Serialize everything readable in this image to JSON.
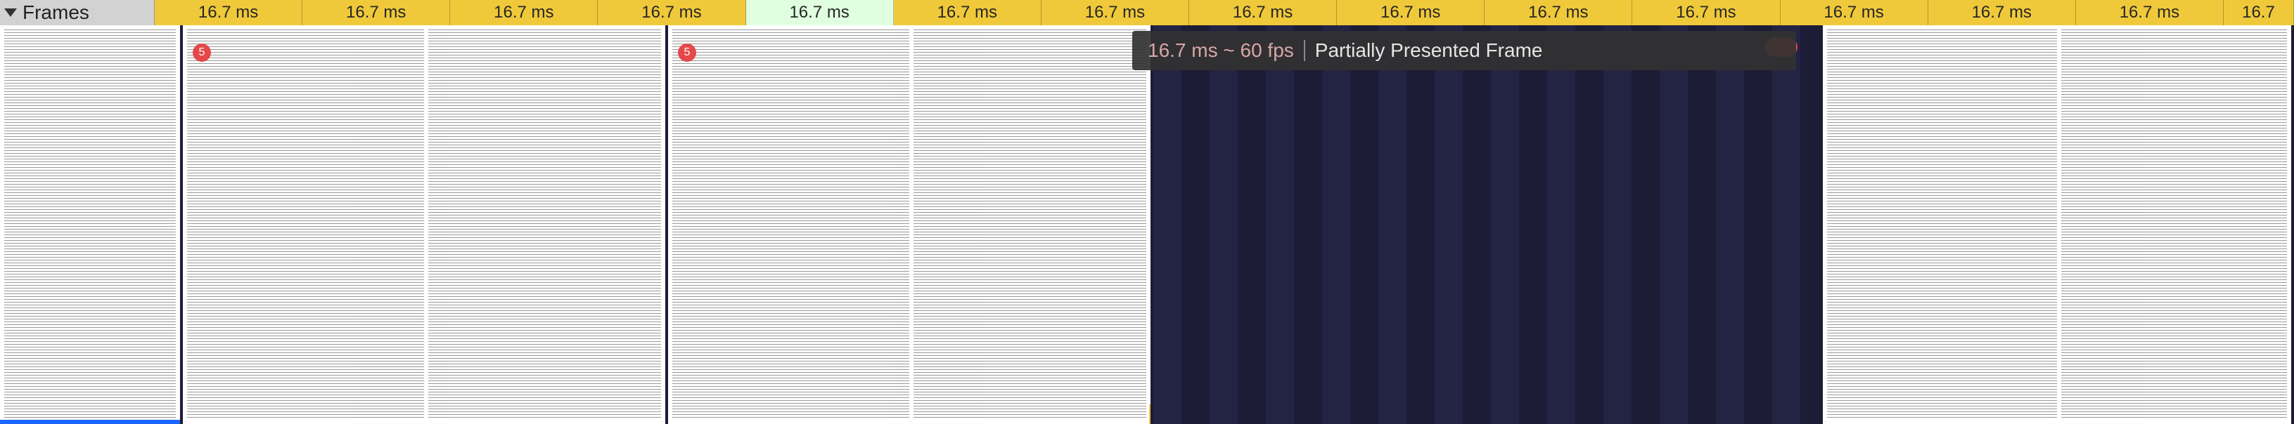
{
  "frames": {
    "row_label": "Frames",
    "cells": [
      {
        "label": "16.7 ms",
        "kind": "gold"
      },
      {
        "label": "16.7 ms",
        "kind": "gold"
      },
      {
        "label": "16.7 ms",
        "kind": "gold"
      },
      {
        "label": "16.7 ms",
        "kind": "gold"
      },
      {
        "label": "16.7 ms",
        "kind": "green"
      },
      {
        "label": "16.7 ms",
        "kind": "gold"
      },
      {
        "label": "16.7 ms",
        "kind": "gold"
      },
      {
        "label": "16.7 ms",
        "kind": "gold"
      },
      {
        "label": "16.7 ms",
        "kind": "gold"
      },
      {
        "label": "16.7 ms",
        "kind": "gold"
      },
      {
        "label": "16.7 ms",
        "kind": "gold"
      },
      {
        "label": "16.7 ms",
        "kind": "gold"
      },
      {
        "label": "16.7 ms",
        "kind": "gold"
      },
      {
        "label": "16.7 ms",
        "kind": "gold"
      },
      {
        "label": "16.7",
        "kind": "gold"
      }
    ]
  },
  "tooltip": {
    "timing": "16.7 ms ~ 60 fps",
    "status": "Partially Presented Frame"
  },
  "markers": {
    "red_label": "5"
  }
}
